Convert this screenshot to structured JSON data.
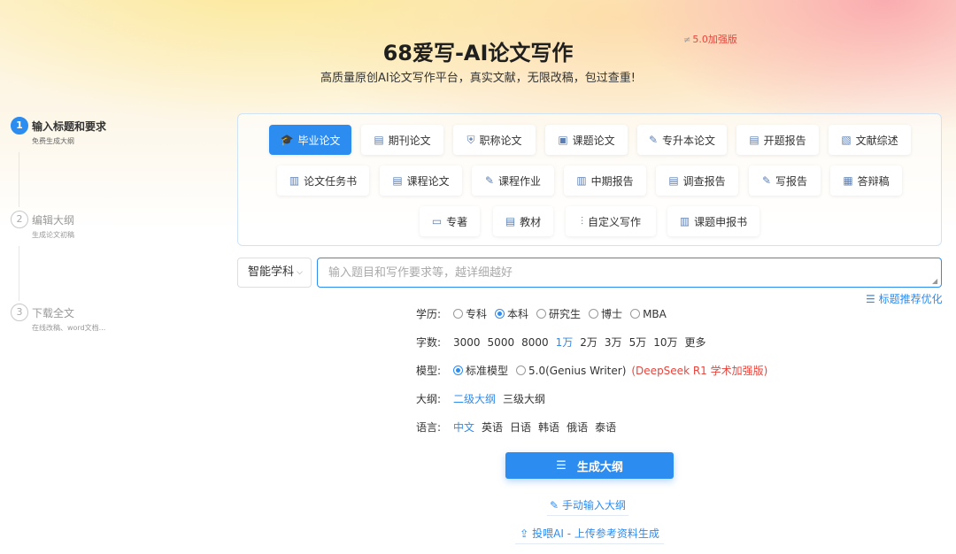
{
  "header": {
    "title": "68爱写-AI论文写作",
    "version_icon": "≠",
    "version_badge": "5.0加强版",
    "subtitle": "高质量原创AI论文写作平台，真实文献，无限改稿，包过查重!"
  },
  "steps": [
    {
      "num": "1",
      "title": "输入标题和要求",
      "desc": "免费生成大纲",
      "active": true
    },
    {
      "num": "2",
      "title": "编辑大纲",
      "desc": "生成论文初稿",
      "active": false
    },
    {
      "num": "3",
      "title": "下载全文",
      "desc": "在线改稿、word文档...",
      "active": false
    }
  ],
  "paper_types": [
    {
      "label": "毕业论文",
      "icon": "graduation-cap-icon",
      "glyph": "🎓",
      "active": true
    },
    {
      "label": "期刊论文",
      "icon": "journal-icon",
      "glyph": "▤",
      "active": false
    },
    {
      "label": "职称论文",
      "icon": "shield-icon",
      "glyph": "⛨",
      "active": false
    },
    {
      "label": "课题论文",
      "icon": "book-icon",
      "glyph": "▣",
      "active": false
    },
    {
      "label": "专升本论文",
      "icon": "document-edit-icon",
      "glyph": "✎",
      "active": false
    },
    {
      "label": "开题报告",
      "icon": "report-icon",
      "glyph": "▤",
      "active": false
    },
    {
      "label": "文献综述",
      "icon": "literature-icon",
      "glyph": "▧",
      "active": false
    },
    {
      "label": "论文任务书",
      "icon": "clipboard-icon",
      "glyph": "▥",
      "active": false
    },
    {
      "label": "课程论文",
      "icon": "document-icon",
      "glyph": "▤",
      "active": false
    },
    {
      "label": "课程作业",
      "icon": "homework-icon",
      "glyph": "✎",
      "active": false
    },
    {
      "label": "中期报告",
      "icon": "clipboard-icon",
      "glyph": "▥",
      "active": false
    },
    {
      "label": "调查报告",
      "icon": "survey-icon",
      "glyph": "▤",
      "active": false
    },
    {
      "label": "写报告",
      "icon": "write-report-icon",
      "glyph": "✎",
      "active": false
    },
    {
      "label": "答辩稿",
      "icon": "defense-icon",
      "glyph": "▦",
      "active": false
    },
    {
      "label": "专著",
      "icon": "monograph-icon",
      "glyph": "▭",
      "active": false
    },
    {
      "label": "教材",
      "icon": "textbook-icon",
      "glyph": "▤",
      "active": false
    },
    {
      "label": "自定义写作",
      "icon": "sliders-icon",
      "glyph": "⫶",
      "active": false
    },
    {
      "label": "课题申报书",
      "icon": "application-icon",
      "glyph": "▥",
      "active": false
    }
  ],
  "subject_select": {
    "value": "智能学科"
  },
  "topic_input": {
    "placeholder": "输入题目和写作要求等，越详细越好",
    "value": ""
  },
  "optimize_link": "标题推荐优化",
  "options": {
    "degree": {
      "label": "学历:",
      "choices": [
        "专科",
        "本科",
        "研究生",
        "博士",
        "MBA"
      ],
      "selected": "本科"
    },
    "words": {
      "label": "字数:",
      "choices": [
        "3000",
        "5000",
        "8000",
        "1万",
        "2万",
        "3万",
        "5万",
        "10万",
        "更多"
      ],
      "selected": "1万"
    },
    "model": {
      "label": "模型:",
      "choices": [
        "标准模型",
        "5.0(Genius Writer)"
      ],
      "selected": "标准模型",
      "note": "(DeepSeek R1 学术加强版)"
    },
    "outline": {
      "label": "大纲:",
      "choices": [
        "二级大纲",
        "三级大纲"
      ],
      "selected": "二级大纲"
    },
    "language": {
      "label": "语言:",
      "choices": [
        "中文",
        "英语",
        "日语",
        "韩语",
        "俄语",
        "泰语"
      ],
      "selected": "中文"
    }
  },
  "actions": {
    "generate": "生成大纲",
    "manual_outline": "手动输入大纲",
    "upload_material": "投喂AI - 上传参考资料生成"
  },
  "colors": {
    "accent": "#2d8cf0",
    "danger": "#e8453c"
  }
}
